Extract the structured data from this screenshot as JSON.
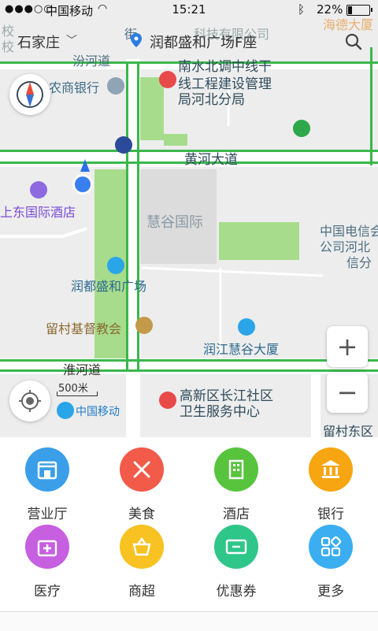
{
  "status_bar": {
    "carrier": "中国移动",
    "time": "15:21",
    "battery": "22%"
  },
  "search_bar": {
    "city": "石家庄",
    "place": "润都盛和广场F座"
  },
  "map": {
    "roads": {
      "fen": "汾河道",
      "huanghe": "黄河大道",
      "huai": "淮河道",
      "jie": "街"
    },
    "labels": {
      "top_partial": "科技有限公司",
      "top_right_partial": "海德大厦",
      "left_partial_1": "校",
      "left_partial_2": "校",
      "bank": "农商银行",
      "water_office_1": "南水北调中线干",
      "water_office_2": "线工程建设管理",
      "water_office_3": "局河北分局",
      "hotel": "上东国际酒店",
      "huigu": "慧谷国际",
      "telecom_1": "中国电信会",
      "telecom_2": "公司河北",
      "telecom_3": "信分",
      "rundu": "润都盛和广场",
      "church": "留村基督教会",
      "runjiang": "润江慧谷大厦",
      "health_1": "高新区长江社区",
      "health_2": "卫生服务中心",
      "liucun": "留村东区",
      "cmcc": "中国移动"
    },
    "scale": "500米",
    "zoom_in": "+",
    "zoom_out": "−"
  },
  "categories": [
    {
      "label": "营业厅",
      "icon": "store-icon",
      "color": "#3a9ee8"
    },
    {
      "label": "美食",
      "icon": "food-icon",
      "color": "#f25a4a"
    },
    {
      "label": "酒店",
      "icon": "hotel-icon",
      "color": "#58c43e"
    },
    {
      "label": "银行",
      "icon": "bank-icon",
      "color": "#f7a511"
    },
    {
      "label": "医疗",
      "icon": "medical-icon",
      "color": "#c65fe0"
    },
    {
      "label": "商超",
      "icon": "supermarket-icon",
      "color": "#f7c222"
    },
    {
      "label": "优惠券",
      "icon": "coupon-icon",
      "color": "#2fc68a"
    },
    {
      "label": "更多",
      "icon": "more-icon",
      "color": "#3aaef0"
    }
  ]
}
